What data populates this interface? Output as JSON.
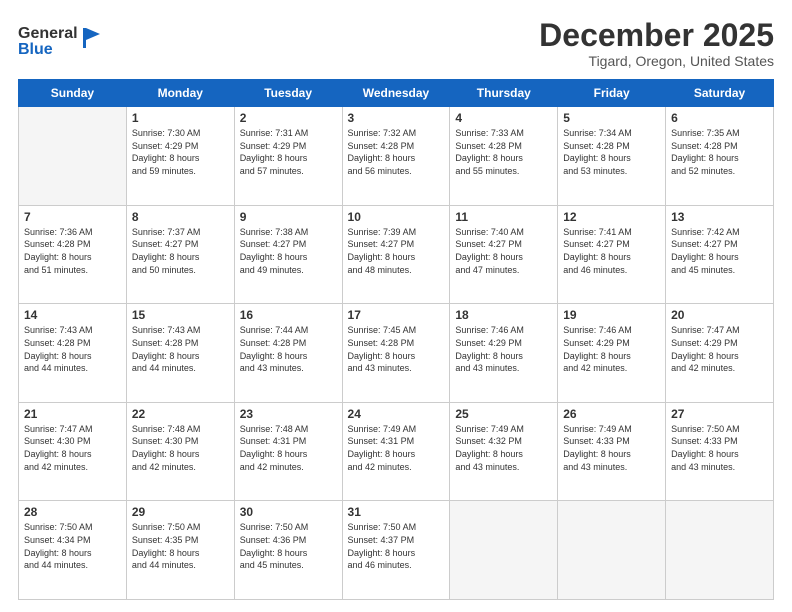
{
  "header": {
    "logo_general": "General",
    "logo_blue": "Blue",
    "month": "December 2025",
    "location": "Tigard, Oregon, United States"
  },
  "days_of_week": [
    "Sunday",
    "Monday",
    "Tuesday",
    "Wednesday",
    "Thursday",
    "Friday",
    "Saturday"
  ],
  "weeks": [
    [
      {
        "day": "",
        "info": ""
      },
      {
        "day": "1",
        "info": "Sunrise: 7:30 AM\nSunset: 4:29 PM\nDaylight: 8 hours\nand 59 minutes."
      },
      {
        "day": "2",
        "info": "Sunrise: 7:31 AM\nSunset: 4:29 PM\nDaylight: 8 hours\nand 57 minutes."
      },
      {
        "day": "3",
        "info": "Sunrise: 7:32 AM\nSunset: 4:28 PM\nDaylight: 8 hours\nand 56 minutes."
      },
      {
        "day": "4",
        "info": "Sunrise: 7:33 AM\nSunset: 4:28 PM\nDaylight: 8 hours\nand 55 minutes."
      },
      {
        "day": "5",
        "info": "Sunrise: 7:34 AM\nSunset: 4:28 PM\nDaylight: 8 hours\nand 53 minutes."
      },
      {
        "day": "6",
        "info": "Sunrise: 7:35 AM\nSunset: 4:28 PM\nDaylight: 8 hours\nand 52 minutes."
      }
    ],
    [
      {
        "day": "7",
        "info": "Sunrise: 7:36 AM\nSunset: 4:28 PM\nDaylight: 8 hours\nand 51 minutes."
      },
      {
        "day": "8",
        "info": "Sunrise: 7:37 AM\nSunset: 4:27 PM\nDaylight: 8 hours\nand 50 minutes."
      },
      {
        "day": "9",
        "info": "Sunrise: 7:38 AM\nSunset: 4:27 PM\nDaylight: 8 hours\nand 49 minutes."
      },
      {
        "day": "10",
        "info": "Sunrise: 7:39 AM\nSunset: 4:27 PM\nDaylight: 8 hours\nand 48 minutes."
      },
      {
        "day": "11",
        "info": "Sunrise: 7:40 AM\nSunset: 4:27 PM\nDaylight: 8 hours\nand 47 minutes."
      },
      {
        "day": "12",
        "info": "Sunrise: 7:41 AM\nSunset: 4:27 PM\nDaylight: 8 hours\nand 46 minutes."
      },
      {
        "day": "13",
        "info": "Sunrise: 7:42 AM\nSunset: 4:27 PM\nDaylight: 8 hours\nand 45 minutes."
      }
    ],
    [
      {
        "day": "14",
        "info": "Sunrise: 7:43 AM\nSunset: 4:28 PM\nDaylight: 8 hours\nand 44 minutes."
      },
      {
        "day": "15",
        "info": "Sunrise: 7:43 AM\nSunset: 4:28 PM\nDaylight: 8 hours\nand 44 minutes."
      },
      {
        "day": "16",
        "info": "Sunrise: 7:44 AM\nSunset: 4:28 PM\nDaylight: 8 hours\nand 43 minutes."
      },
      {
        "day": "17",
        "info": "Sunrise: 7:45 AM\nSunset: 4:28 PM\nDaylight: 8 hours\nand 43 minutes."
      },
      {
        "day": "18",
        "info": "Sunrise: 7:46 AM\nSunset: 4:29 PM\nDaylight: 8 hours\nand 43 minutes."
      },
      {
        "day": "19",
        "info": "Sunrise: 7:46 AM\nSunset: 4:29 PM\nDaylight: 8 hours\nand 42 minutes."
      },
      {
        "day": "20",
        "info": "Sunrise: 7:47 AM\nSunset: 4:29 PM\nDaylight: 8 hours\nand 42 minutes."
      }
    ],
    [
      {
        "day": "21",
        "info": "Sunrise: 7:47 AM\nSunset: 4:30 PM\nDaylight: 8 hours\nand 42 minutes."
      },
      {
        "day": "22",
        "info": "Sunrise: 7:48 AM\nSunset: 4:30 PM\nDaylight: 8 hours\nand 42 minutes."
      },
      {
        "day": "23",
        "info": "Sunrise: 7:48 AM\nSunset: 4:31 PM\nDaylight: 8 hours\nand 42 minutes."
      },
      {
        "day": "24",
        "info": "Sunrise: 7:49 AM\nSunset: 4:31 PM\nDaylight: 8 hours\nand 42 minutes."
      },
      {
        "day": "25",
        "info": "Sunrise: 7:49 AM\nSunset: 4:32 PM\nDaylight: 8 hours\nand 43 minutes."
      },
      {
        "day": "26",
        "info": "Sunrise: 7:49 AM\nSunset: 4:33 PM\nDaylight: 8 hours\nand 43 minutes."
      },
      {
        "day": "27",
        "info": "Sunrise: 7:50 AM\nSunset: 4:33 PM\nDaylight: 8 hours\nand 43 minutes."
      }
    ],
    [
      {
        "day": "28",
        "info": "Sunrise: 7:50 AM\nSunset: 4:34 PM\nDaylight: 8 hours\nand 44 minutes."
      },
      {
        "day": "29",
        "info": "Sunrise: 7:50 AM\nSunset: 4:35 PM\nDaylight: 8 hours\nand 44 minutes."
      },
      {
        "day": "30",
        "info": "Sunrise: 7:50 AM\nSunset: 4:36 PM\nDaylight: 8 hours\nand 45 minutes."
      },
      {
        "day": "31",
        "info": "Sunrise: 7:50 AM\nSunset: 4:37 PM\nDaylight: 8 hours\nand 46 minutes."
      },
      {
        "day": "",
        "info": ""
      },
      {
        "day": "",
        "info": ""
      },
      {
        "day": "",
        "info": ""
      }
    ]
  ]
}
